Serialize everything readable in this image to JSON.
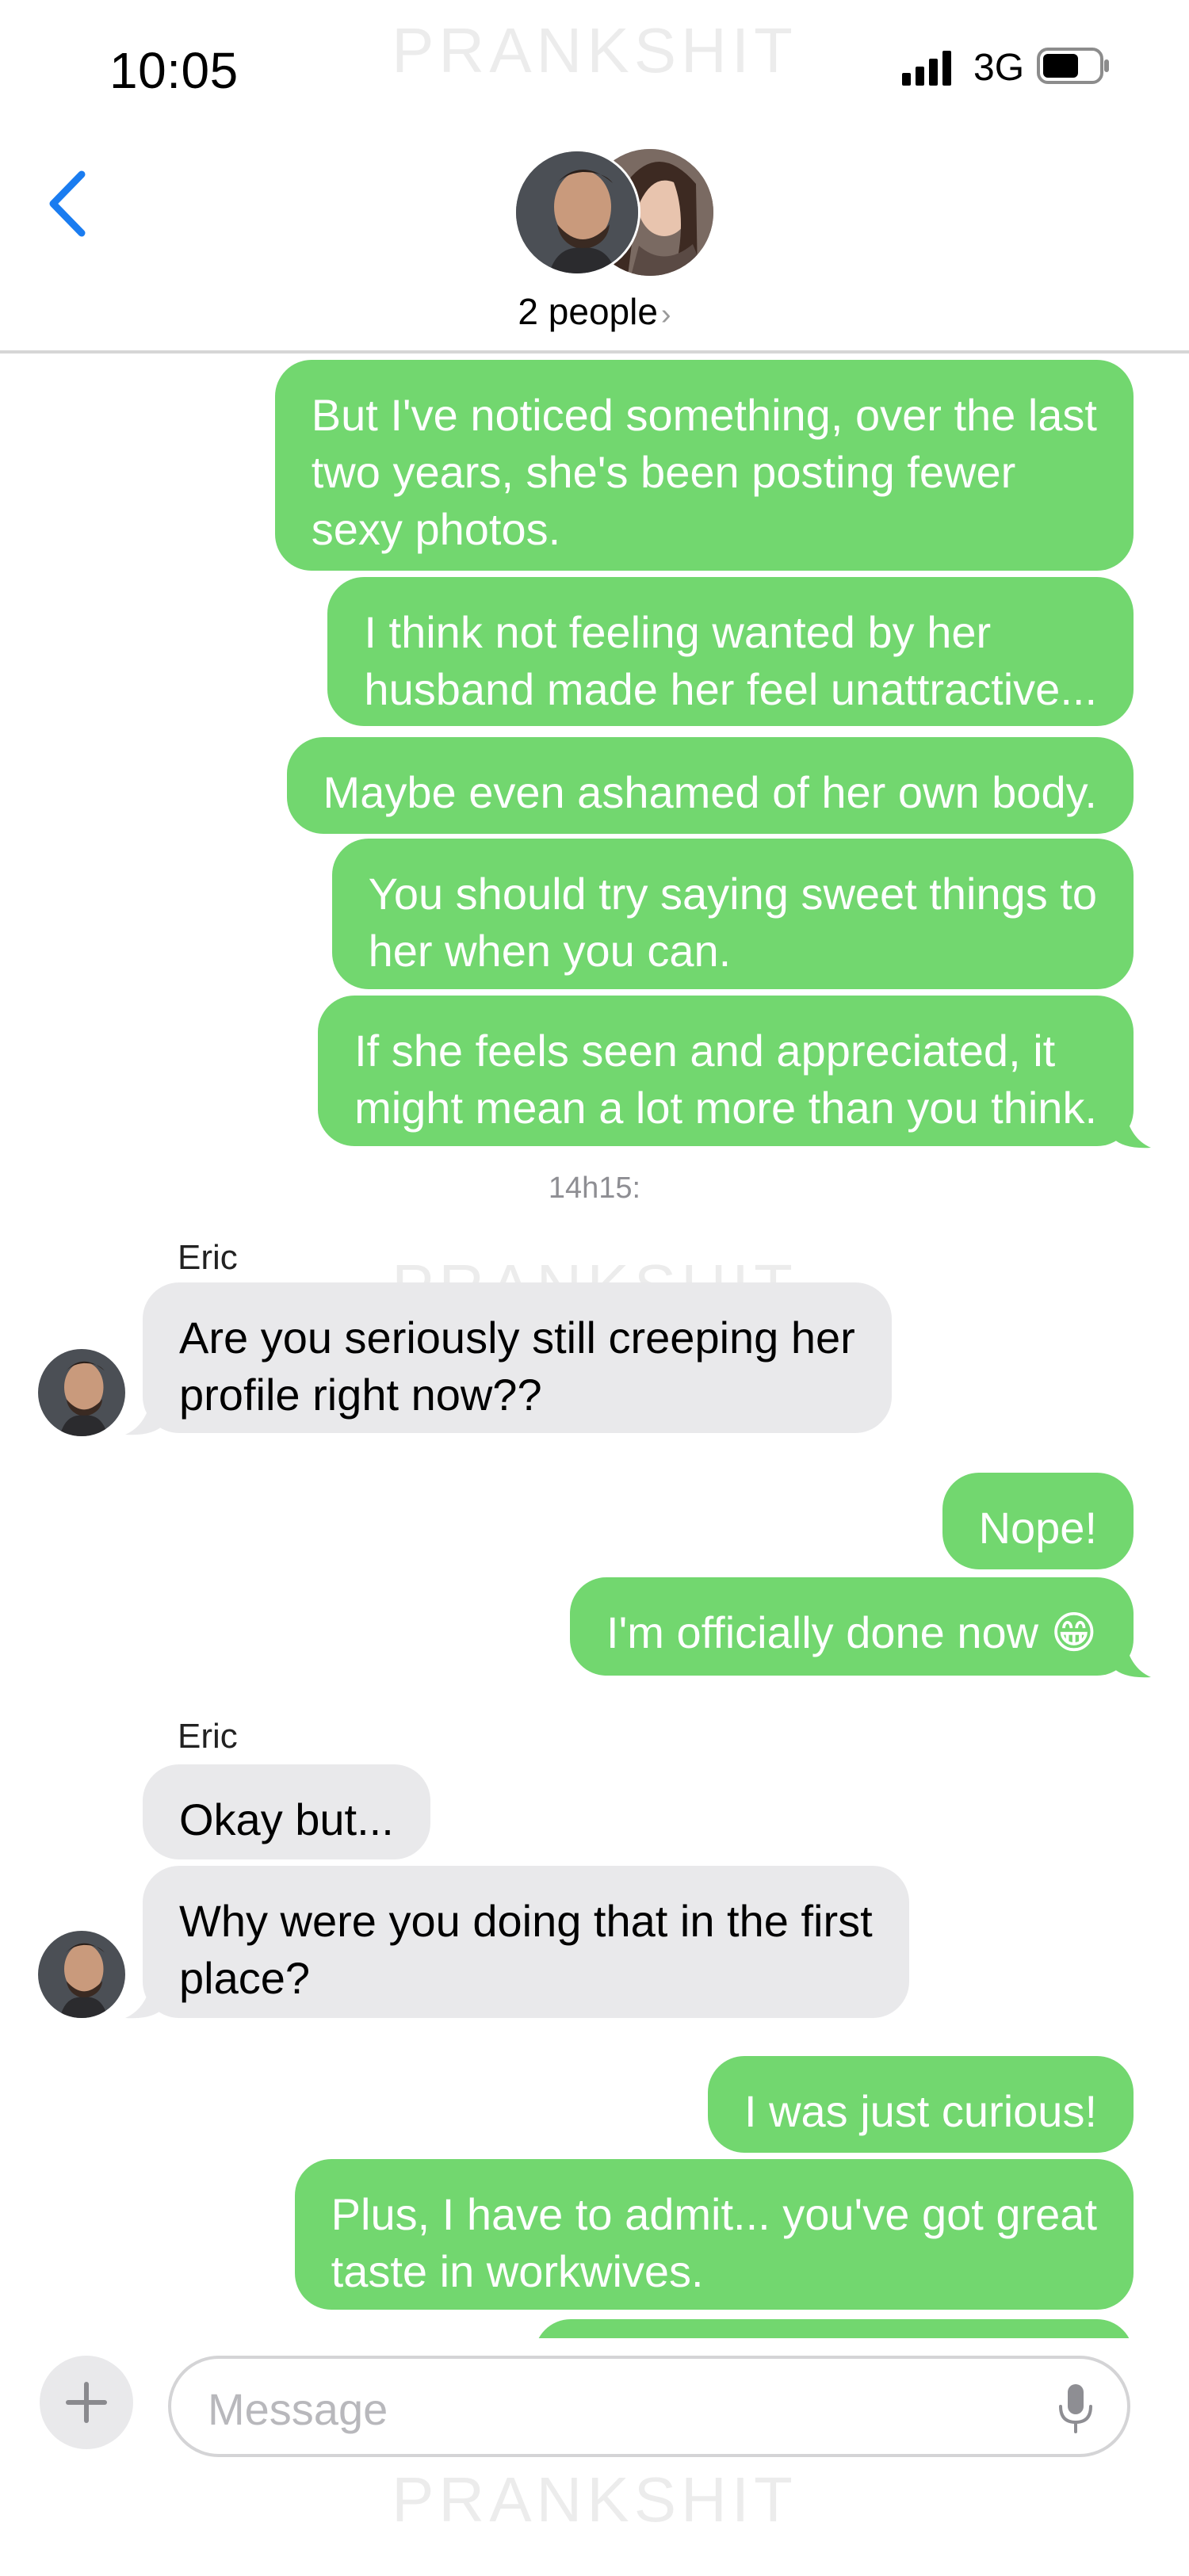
{
  "status_bar": {
    "time": "10:05",
    "network": "3G",
    "icons": [
      "signal-bars-icon",
      "battery-icon"
    ]
  },
  "watermark": "PRANKSHIT",
  "header": {
    "back_icon": "chevron-left-icon",
    "group_label": "2 people",
    "chevron": "›"
  },
  "colors": {
    "outgoing_bubble": "#72d76f",
    "incoming_bubble": "#e9e9eb",
    "accent": "#1a7cf0"
  },
  "messages": [
    {
      "dir": "out",
      "lines": [
        "But I've noticed something, over the last",
        "two years, she's been posting fewer",
        "sexy photos."
      ]
    },
    {
      "dir": "out",
      "lines": [
        "I think not feeling wanted by her",
        "husband made her feel unattractive..."
      ]
    },
    {
      "dir": "out",
      "lines": [
        "Maybe even ashamed of her own body."
      ]
    },
    {
      "dir": "out",
      "lines": [
        "You should try saying sweet things to",
        "her when you can."
      ]
    },
    {
      "dir": "out",
      "lines": [
        "If she feels seen and appreciated, it",
        "might mean a lot more than you think."
      ]
    },
    {
      "timestamp": "14h15:"
    },
    {
      "sender": "Eric"
    },
    {
      "dir": "in",
      "lines": [
        "Are you seriously still creeping her",
        "profile right now??"
      ]
    },
    {
      "dir": "out",
      "lines": [
        "Nope!"
      ]
    },
    {
      "dir": "out",
      "lines": [
        "I'm officially done now 😁"
      ]
    },
    {
      "sender": "Eric"
    },
    {
      "dir": "in",
      "lines": [
        "Okay but..."
      ]
    },
    {
      "dir": "in",
      "lines": [
        "Why were you doing that in the first",
        "place?"
      ]
    },
    {
      "dir": "out",
      "lines": [
        "I was just curious!"
      ]
    },
    {
      "dir": "out",
      "lines": [
        "Plus, I have to admit... you've got great",
        "taste in workwives."
      ]
    }
  ],
  "composer": {
    "placeholder": "Message",
    "plus_icon": "plus-icon",
    "mic_icon": "microphone-icon"
  }
}
